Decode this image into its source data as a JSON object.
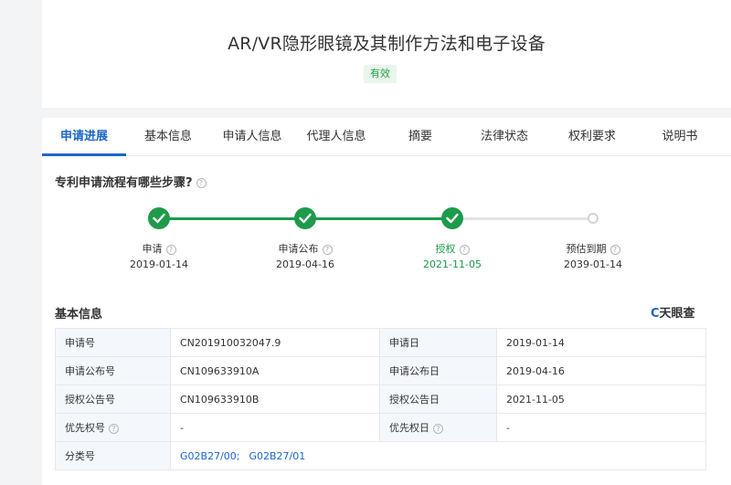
{
  "header": {
    "title": "AR/VR隐形眼镜及其制作方法和电子设备",
    "status_badge": "有效"
  },
  "tabs": [
    {
      "label": "申请进展",
      "active": true
    },
    {
      "label": "基本信息"
    },
    {
      "label": "申请人信息"
    },
    {
      "label": "代理人信息"
    },
    {
      "label": "摘要"
    },
    {
      "label": "法律状态"
    },
    {
      "label": "权利要求"
    },
    {
      "label": "说明书"
    }
  ],
  "progress": {
    "question": "专利申请流程有哪些步骤?",
    "steps": [
      {
        "label": "申请",
        "date": "2019-01-14",
        "status": "done"
      },
      {
        "label": "申请公布",
        "date": "2019-04-16",
        "status": "done"
      },
      {
        "label": "授权",
        "date": "2021-11-05",
        "status": "done",
        "current": true
      },
      {
        "label": "预估到期",
        "date": "2039-01-14",
        "status": "pending"
      }
    ]
  },
  "basic_info": {
    "title": "基本信息",
    "brand": "天眼查",
    "brand_icon_char": "C",
    "rows": [
      {
        "label1": "申请号",
        "value1": "CN201910032047.9",
        "label2": "申请日",
        "value2": "2019-01-14"
      },
      {
        "label1": "申请公布号",
        "value1": "CN109633910A",
        "label2": "申请公布日",
        "value2": "2019-04-16"
      },
      {
        "label1": "授权公告号",
        "value1": "CN109633910B",
        "label2": "授权公告日",
        "value2": "2021-11-05"
      },
      {
        "label1": "优先权号",
        "value1": "-",
        "label2": "优先权日",
        "value2": "-"
      }
    ],
    "classification": {
      "label": "分类号",
      "codes": [
        "G02B27/00;",
        "G02B27/01"
      ]
    }
  },
  "colors": {
    "accent_blue": "#1a66c9",
    "success_green": "#1e9a4b",
    "badge_bg": "#e8f6ec",
    "table_label_bg": "#f4f8fd",
    "page_bg": "#f3f4f6"
  }
}
